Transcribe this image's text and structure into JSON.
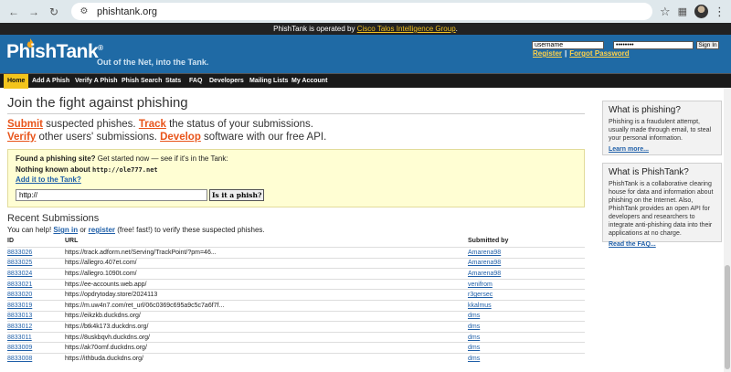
{
  "browser": {
    "url": "phishtank.org"
  },
  "banner": {
    "text": "PhishTank is operated by",
    "link": "Cisco Talos Intelligence Group",
    "end": "."
  },
  "header": {
    "logo_text": "PhishTank",
    "logo_mark": "®",
    "tagline": "Out of the Net, into the Tank.",
    "login": {
      "username": "username",
      "password": "••••••••",
      "signin_label": "Sign In",
      "register_label": "Register",
      "separator": "|",
      "forgot_label": "Forgot Password"
    }
  },
  "nav": {
    "items": [
      "Home",
      "Add A Phish",
      "Verify A Phish",
      "Phish Search",
      "Stats",
      "FAQ",
      "Developers",
      "Mailing Lists",
      "My Account"
    ]
  },
  "main": {
    "headline": "Join the fight against phishing",
    "pitch": {
      "submit": "Submit",
      "submit_rest": " suspected phishes. ",
      "track": "Track",
      "track_rest": " the status of your submissions.",
      "verify": "Verify",
      "verify_rest": " other users' submissions. ",
      "develop": "Develop",
      "develop_rest": " software with our free API."
    },
    "found": {
      "question_bold": "Found a phishing site?",
      "question_rest": " Get started now — see if it's in the Tank:",
      "nothing_known": "Nothing known about ",
      "checked_url": "http://ole777.net",
      "add_link": "Add it to the Tank?",
      "input_value": "http://",
      "check_button": "Is it a phish?"
    },
    "recent": {
      "title": "Recent Submissions",
      "help_pre": "You can help! ",
      "sign_in": "Sign in",
      "help_mid": " or ",
      "register": "register",
      "help_post": " (free! fast!) to verify these suspected phishes.",
      "columns": [
        "ID",
        "URL",
        "Submitted by"
      ],
      "rows": [
        {
          "id": "8833026",
          "url": "https://track.adform.net/Serving/TrackPoint/?pm=46...",
          "by": "Amarena98"
        },
        {
          "id": "8833025",
          "url": "https://allegro.407et.com/",
          "by": "Amarena98"
        },
        {
          "id": "8833024",
          "url": "https://allegro.1090t.com/",
          "by": "Amarena98"
        },
        {
          "id": "8833021",
          "url": "https://ee-accounts.web.app/",
          "by": "venifrom"
        },
        {
          "id": "8833020",
          "url": "https://opdrytoday.store/2024113",
          "by": "r3gersec"
        },
        {
          "id": "8833019",
          "url": "https://m.uw4n7.com/ret_url/06c0369c695a9c5c7a6f7f...",
          "by": "kkalmus"
        },
        {
          "id": "8833013",
          "url": "https://eikzkb.duckdns.org/",
          "by": "dms"
        },
        {
          "id": "8833012",
          "url": "https://btk4k173.duckdns.org/",
          "by": "dms"
        },
        {
          "id": "8833011",
          "url": "https://8uskbqvh.duckdns.org/",
          "by": "dms"
        },
        {
          "id": "8833009",
          "url": "https://ak70omf.duckdns.org/",
          "by": "dms"
        },
        {
          "id": "8833008",
          "url": "https://ithbuda.duckdns.org/",
          "by": "dms"
        }
      ]
    }
  },
  "sidebar": {
    "what_phishing": {
      "title": "What is phishing?",
      "body": "Phishing is a fraudulent attempt, usually made through email, to steal your personal information.",
      "link": "Learn more..."
    },
    "what_phishtank": {
      "title": "What is PhishTank?",
      "body": "PhishTank is a collaborative clearing house for data and information about phishing on the Internet. Also, PhishTank provides an open API for developers and researchers to integrate anti-phishing data into their applications at no charge.",
      "link": "Read the FAQ..."
    }
  },
  "colors": {
    "header_blue": "#1f6aa5",
    "nav_active": "#f3c41c",
    "accent_orange": "#e8541a",
    "link_blue": "#1f5fa8",
    "found_box_bg": "#fffed3"
  }
}
